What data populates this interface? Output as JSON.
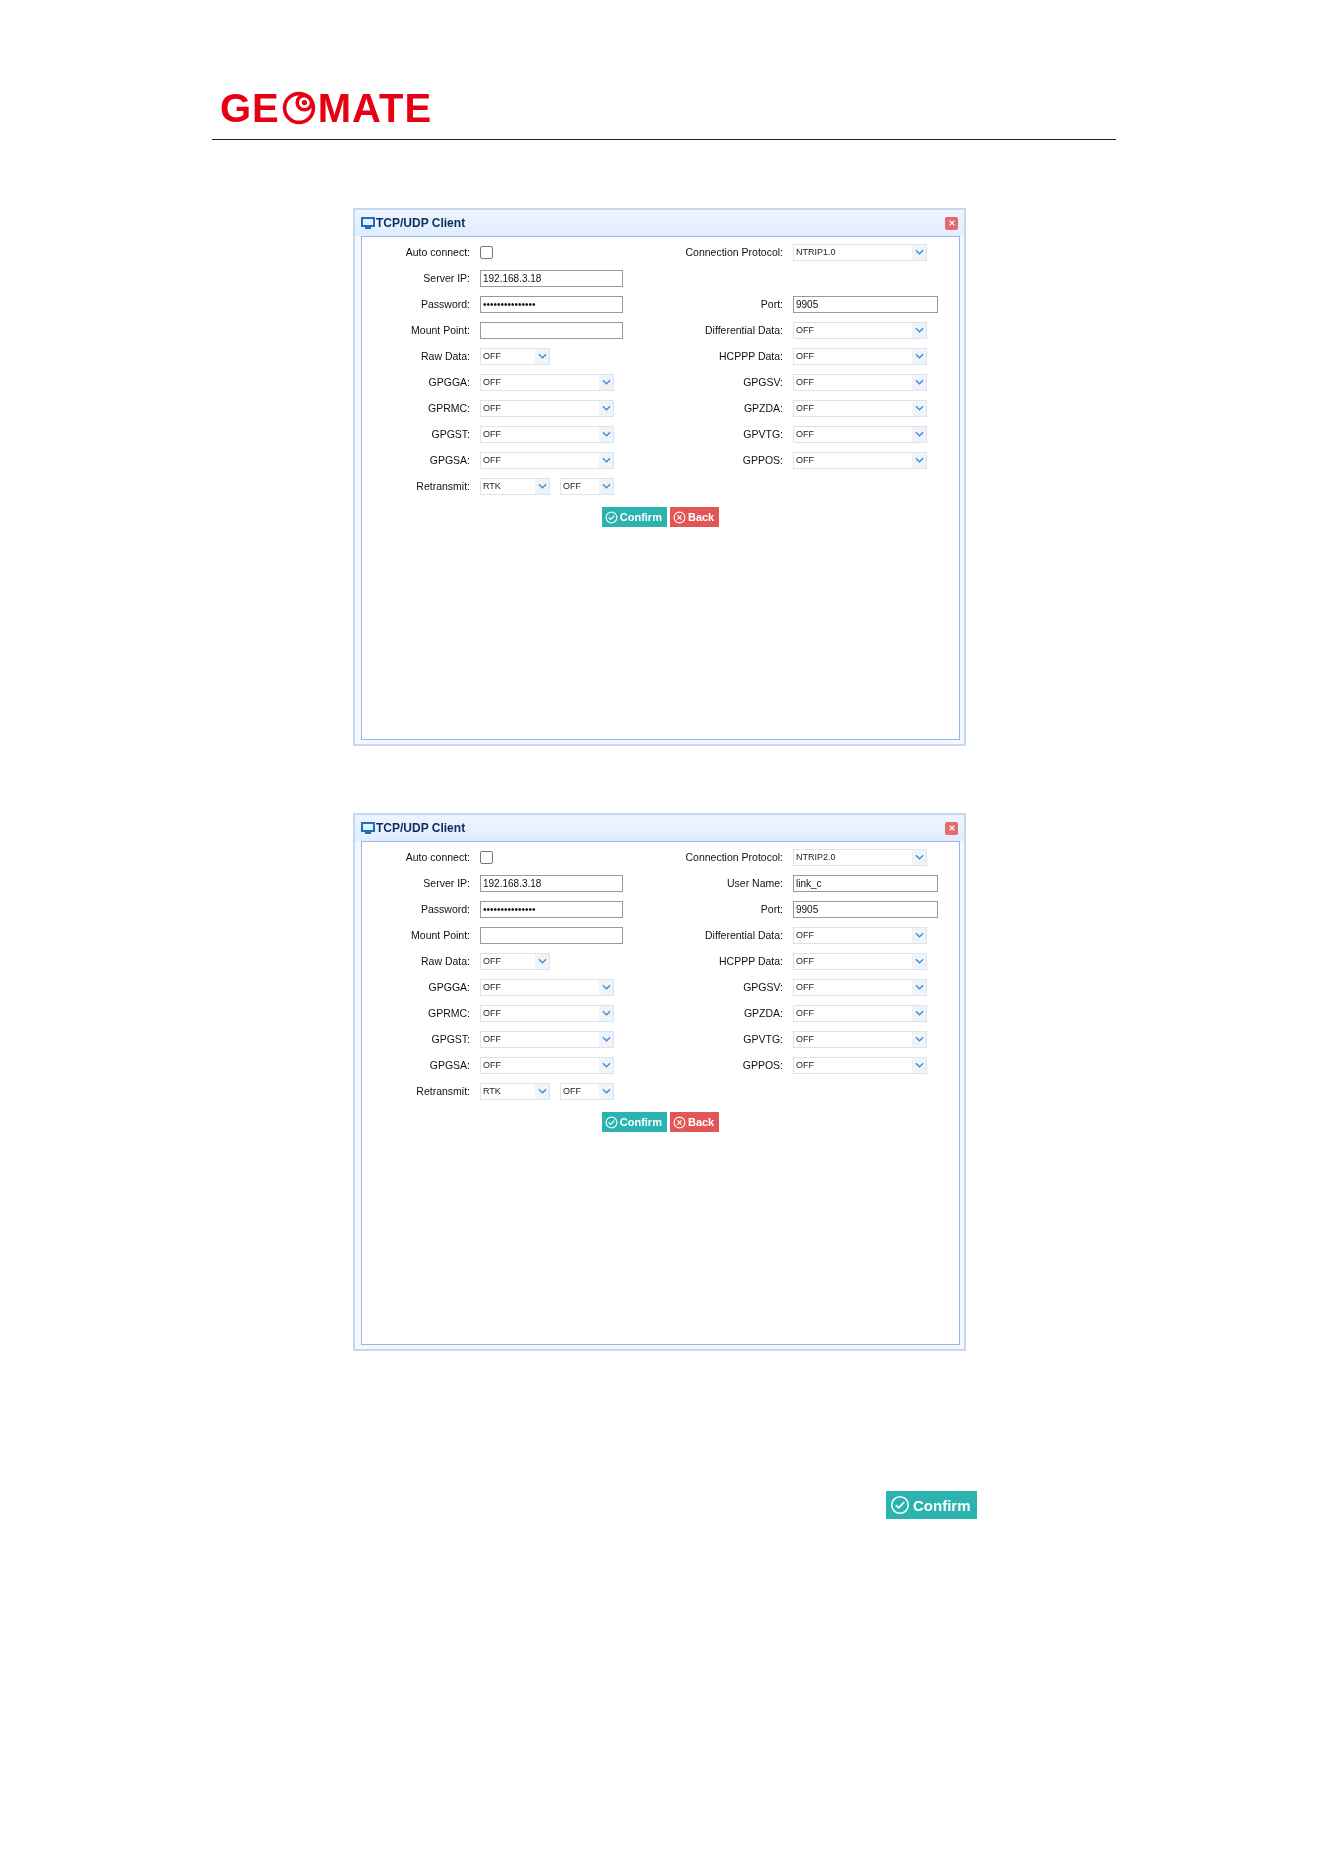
{
  "logo": {
    "before": "GE",
    "after": "MATE"
  },
  "dialogs": [
    {
      "title": "TCP/UDP Client",
      "rows": [
        {
          "left": {
            "kind": "checkbox",
            "label": "Auto connect:",
            "checked": false
          },
          "right": {
            "kind": "select",
            "label": "Connection Protocol:",
            "value": "NTRIP1.0"
          }
        },
        {
          "left": {
            "kind": "text",
            "label": "Server IP:",
            "value": "192.168.3.18"
          }
        },
        {
          "left": {
            "kind": "text",
            "label": "Password:",
            "value": "•••••••••••••••"
          },
          "right": {
            "kind": "text",
            "label": "Port:",
            "value": "9905"
          }
        },
        {
          "left": {
            "kind": "text",
            "label": "Mount Point:"
          },
          "right": {
            "kind": "select",
            "label": "Differential Data:",
            "value": "OFF"
          }
        },
        {
          "left": {
            "kind": "short_select",
            "label": "Raw Data:",
            "value": "OFF"
          },
          "right": {
            "kind": "select",
            "label": "HCPPP Data:",
            "value": "OFF"
          }
        },
        {
          "left": {
            "kind": "select",
            "label": "GPGGA:",
            "value": "OFF"
          },
          "right": {
            "kind": "select",
            "label": "GPGSV:",
            "value": "OFF"
          }
        },
        {
          "left": {
            "kind": "select",
            "label": "GPRMC:",
            "value": "OFF"
          },
          "right": {
            "kind": "select",
            "label": "GPZDA:",
            "value": "OFF"
          }
        },
        {
          "left": {
            "kind": "select",
            "label": "GPGST:",
            "value": "OFF"
          },
          "right": {
            "kind": "select",
            "label": "GPVTG:",
            "value": "OFF"
          }
        },
        {
          "left": {
            "kind": "select",
            "label": "GPGSA:",
            "value": "OFF"
          },
          "right": {
            "kind": "select",
            "label": "GPPOS:",
            "value": "OFF"
          }
        },
        {
          "left": {
            "kind": "double_select",
            "label": "Retransmit:",
            "values": [
              "RTK",
              "OFF"
            ]
          }
        }
      ],
      "buttons": [
        {
          "kind": "confirm",
          "label": "Confirm"
        },
        {
          "kind": "back",
          "label": "Back"
        }
      ]
    },
    {
      "title": "TCP/UDP Client",
      "rows": [
        {
          "left": {
            "kind": "checkbox",
            "label": "Auto connect:",
            "checked": false
          },
          "right": {
            "kind": "select",
            "label": "Connection Protocol:",
            "value": "NTRIP2.0"
          }
        },
        {
          "left": {
            "kind": "text",
            "label": "Server IP:",
            "value": "192.168.3.18"
          },
          "right": {
            "kind": "text",
            "label": "User Name:",
            "value": "link_c"
          }
        },
        {
          "left": {
            "kind": "text",
            "label": "Password:",
            "value": "•••••••••••••••"
          },
          "right": {
            "kind": "text",
            "label": "Port:",
            "value": "9905"
          }
        },
        {
          "left": {
            "kind": "text",
            "label": "Mount Point:"
          },
          "right": {
            "kind": "select",
            "label": "Differential Data:",
            "value": "OFF"
          }
        },
        {
          "left": {
            "kind": "short_select",
            "label": "Raw Data:",
            "value": "OFF"
          },
          "right": {
            "kind": "select",
            "label": "HCPPP Data:",
            "value": "OFF"
          }
        },
        {
          "left": {
            "kind": "select",
            "label": "GPGGA:",
            "value": "OFF"
          },
          "right": {
            "kind": "select",
            "label": "GPGSV:",
            "value": "OFF"
          }
        },
        {
          "left": {
            "kind": "select",
            "label": "GPRMC:",
            "value": "OFF"
          },
          "right": {
            "kind": "select",
            "label": "GPZDA:",
            "value": "OFF"
          }
        },
        {
          "left": {
            "kind": "select",
            "label": "GPGST:",
            "value": "OFF"
          },
          "right": {
            "kind": "select",
            "label": "GPVTG:",
            "value": "OFF"
          }
        },
        {
          "left": {
            "kind": "select",
            "label": "GPGSA:",
            "value": "OFF"
          },
          "right": {
            "kind": "select",
            "label": "GPPOS:",
            "value": "OFF"
          }
        },
        {
          "left": {
            "kind": "double_select",
            "label": "Retransmit:",
            "values": [
              "RTK",
              "OFF"
            ]
          }
        }
      ],
      "buttons": [
        {
          "kind": "confirm",
          "label": "Confirm"
        },
        {
          "kind": "back",
          "label": "Back"
        }
      ]
    }
  ],
  "standalone_button": {
    "kind": "confirm",
    "label": "Confirm"
  }
}
